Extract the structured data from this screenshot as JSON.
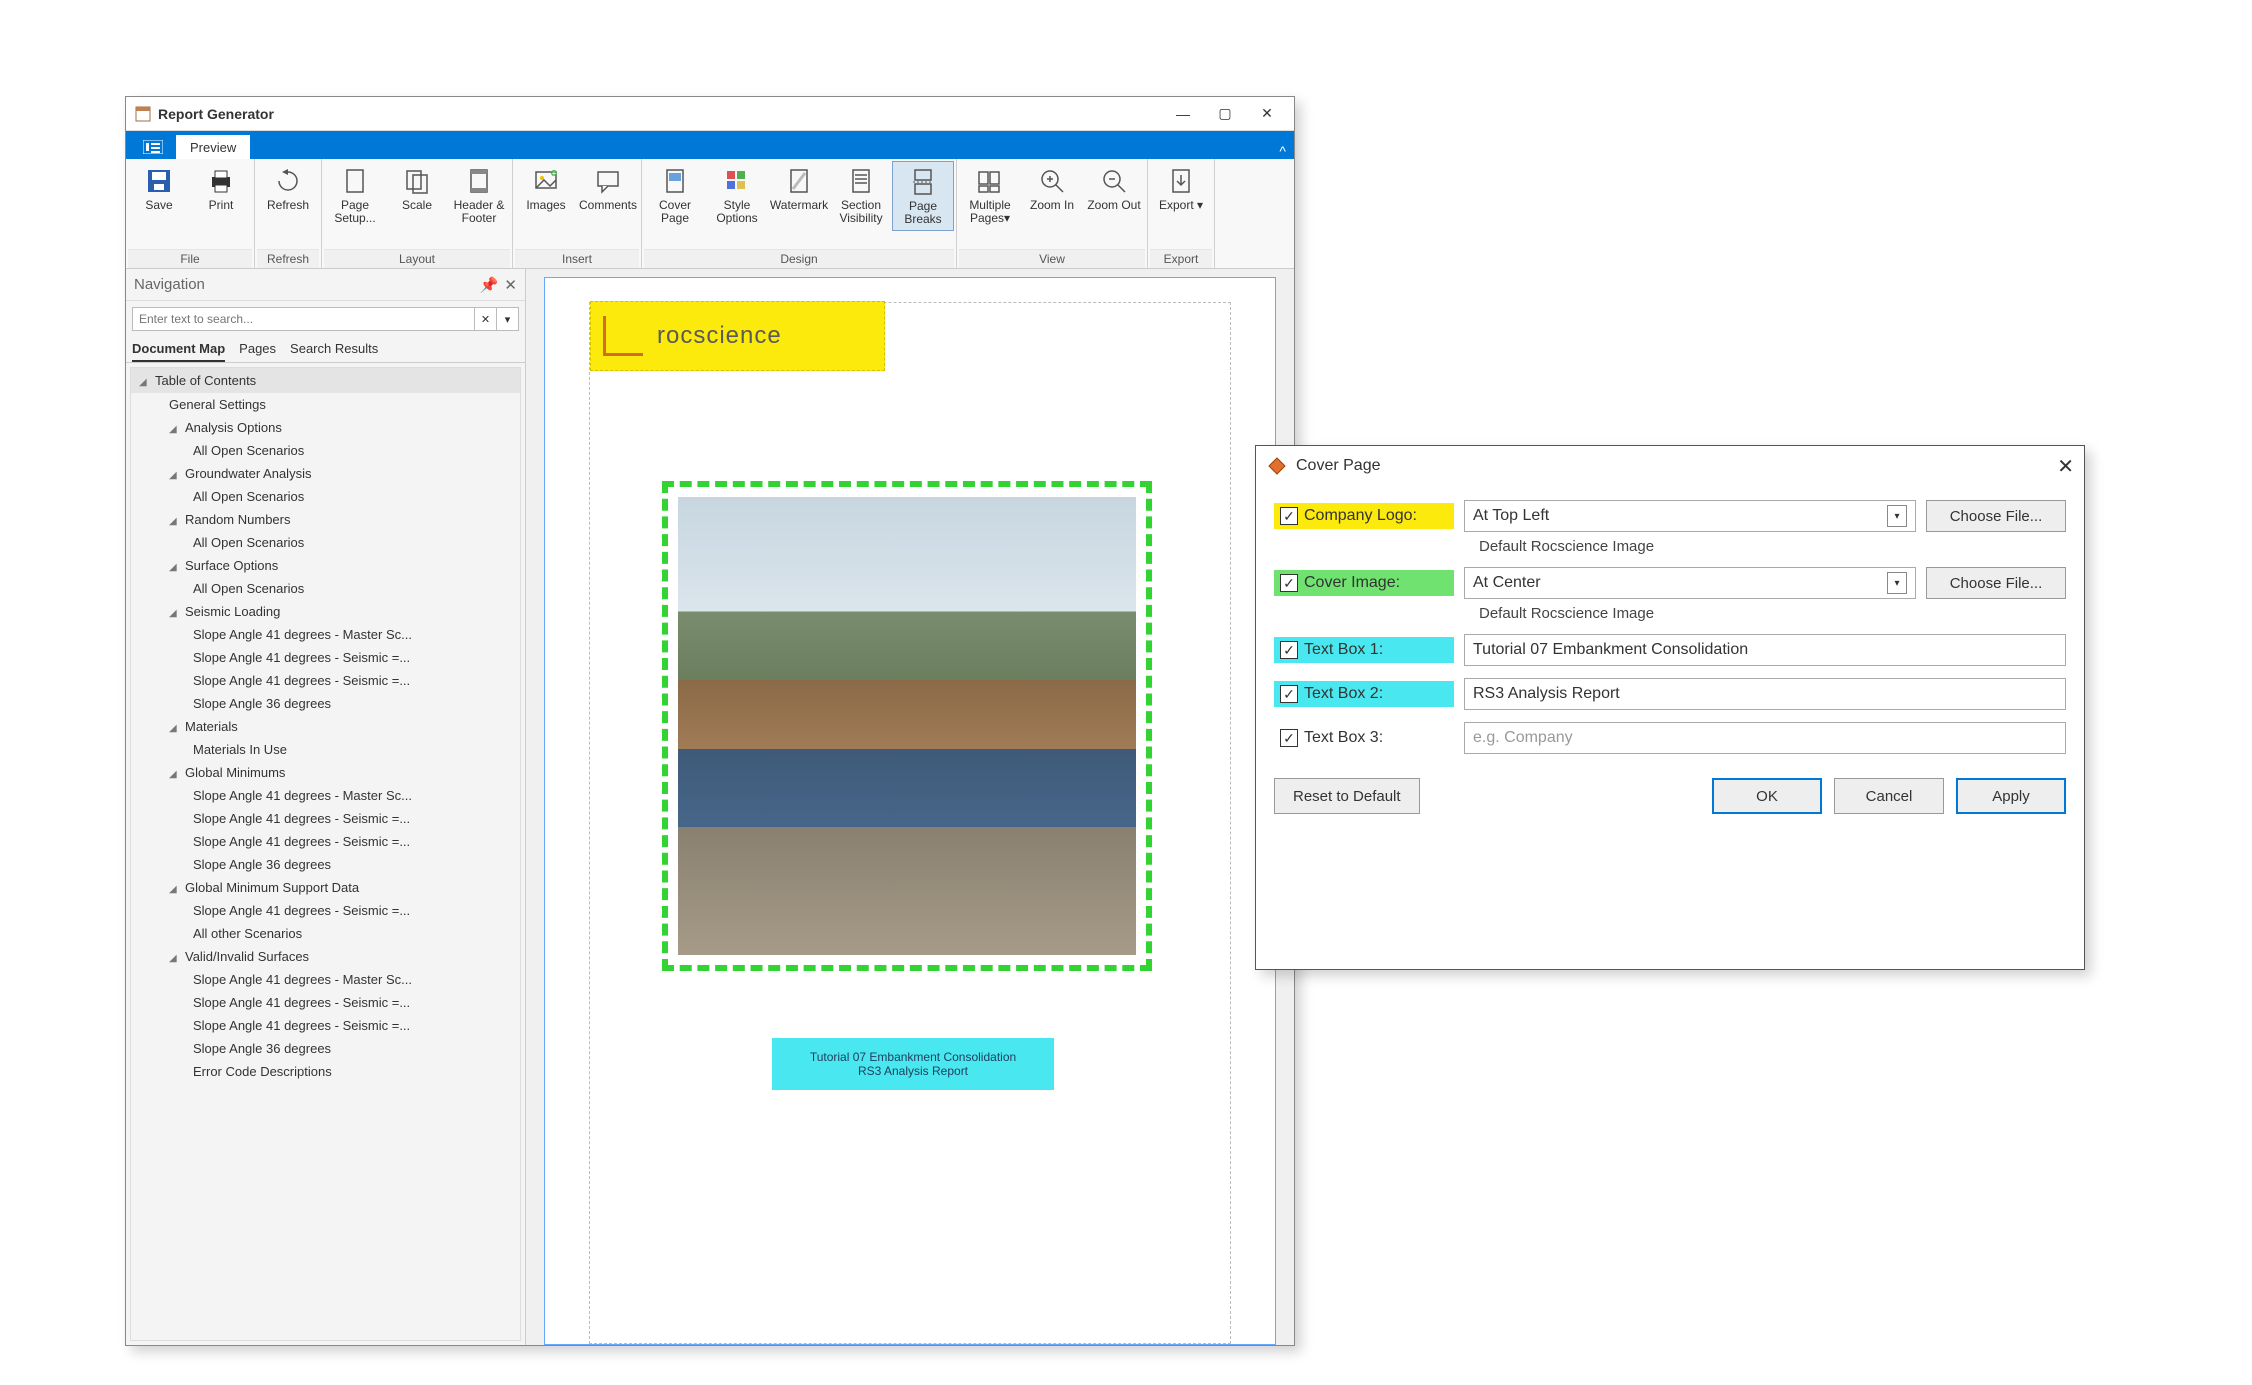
{
  "mainWindow": {
    "title": "Report Generator",
    "ribbonTab": "Preview",
    "ribbon": {
      "groups": [
        {
          "label": "File",
          "buttons": [
            {
              "id": "save",
              "label": "Save"
            },
            {
              "id": "print",
              "label": "Print"
            }
          ]
        },
        {
          "label": "Refresh",
          "buttons": [
            {
              "id": "refresh",
              "label": "Refresh"
            }
          ]
        },
        {
          "label": "Layout",
          "buttons": [
            {
              "id": "page-setup",
              "label": "Page Setup..."
            },
            {
              "id": "scale",
              "label": "Scale"
            },
            {
              "id": "header-footer",
              "label": "Header & Footer"
            }
          ]
        },
        {
          "label": "Insert",
          "buttons": [
            {
              "id": "images",
              "label": "Images"
            },
            {
              "id": "comments",
              "label": "Comments"
            }
          ]
        },
        {
          "label": "Design",
          "buttons": [
            {
              "id": "cover-page",
              "label": "Cover Page"
            },
            {
              "id": "style-options",
              "label": "Style Options"
            },
            {
              "id": "watermark",
              "label": "Watermark"
            },
            {
              "id": "section-visibility",
              "label": "Section Visibility"
            },
            {
              "id": "page-breaks",
              "label": "Page Breaks",
              "active": true
            }
          ]
        },
        {
          "label": "View",
          "buttons": [
            {
              "id": "multiple-pages",
              "label": "Multiple Pages▾"
            },
            {
              "id": "zoom-in",
              "label": "Zoom In"
            },
            {
              "id": "zoom-out",
              "label": "Zoom Out"
            }
          ]
        },
        {
          "label": "Export",
          "buttons": [
            {
              "id": "export",
              "label": "Export ▾"
            }
          ]
        }
      ]
    },
    "nav": {
      "title": "Navigation",
      "searchPlaceholder": "Enter text to search...",
      "tabs": [
        "Document Map",
        "Pages",
        "Search Results"
      ],
      "activeTab": 0,
      "toc": "Table of Contents",
      "items": [
        {
          "t": "General Settings",
          "l": 1
        },
        {
          "t": "Analysis Options",
          "l": 1,
          "exp": true
        },
        {
          "t": "All Open Scenarios",
          "l": 2
        },
        {
          "t": "Groundwater Analysis",
          "l": 1,
          "exp": true
        },
        {
          "t": "All Open Scenarios",
          "l": 2
        },
        {
          "t": "Random Numbers",
          "l": 1,
          "exp": true
        },
        {
          "t": "All Open Scenarios",
          "l": 2
        },
        {
          "t": "Surface Options",
          "l": 1,
          "exp": true
        },
        {
          "t": "All Open Scenarios",
          "l": 2
        },
        {
          "t": "Seismic Loading",
          "l": 1,
          "exp": true
        },
        {
          "t": "Slope Angle 41 degrees - Master Sc...",
          "l": 2
        },
        {
          "t": "Slope Angle 41 degrees - Seismic =...",
          "l": 2
        },
        {
          "t": "Slope Angle 41 degrees - Seismic =...",
          "l": 2
        },
        {
          "t": "Slope Angle 36 degrees",
          "l": 2
        },
        {
          "t": "Materials",
          "l": 1,
          "exp": true
        },
        {
          "t": "Materials In Use",
          "l": 2
        },
        {
          "t": "Global Minimums",
          "l": 1,
          "exp": true
        },
        {
          "t": "Slope Angle 41 degrees - Master Sc...",
          "l": 2
        },
        {
          "t": "Slope Angle 41 degrees - Seismic =...",
          "l": 2
        },
        {
          "t": "Slope Angle 41 degrees - Seismic =...",
          "l": 2
        },
        {
          "t": "Slope Angle 36 degrees",
          "l": 2
        },
        {
          "t": "Global Minimum Support Data",
          "l": 1,
          "exp": true
        },
        {
          "t": "Slope Angle 41 degrees - Seismic =...",
          "l": 2
        },
        {
          "t": "All other Scenarios",
          "l": 2
        },
        {
          "t": "Valid/Invalid Surfaces",
          "l": 1,
          "exp": true
        },
        {
          "t": "Slope Angle 41 degrees - Master Sc...",
          "l": 2
        },
        {
          "t": "Slope Angle 41 degrees - Seismic =...",
          "l": 2
        },
        {
          "t": "Slope Angle 41 degrees - Seismic =...",
          "l": 2
        },
        {
          "t": "Slope Angle 36 degrees",
          "l": 2
        },
        {
          "t": "Error Code Descriptions",
          "l": 2
        }
      ]
    },
    "preview": {
      "logoText": "rocscience",
      "textBox1": "Tutorial 07 Embankment Consolidation",
      "textBox2": "RS3 Analysis Report"
    }
  },
  "dialog": {
    "title": "Cover Page",
    "rows": {
      "companyLogo": {
        "label": "Company Logo:",
        "value": "At Top Left",
        "button": "Choose File...",
        "sub": "Default Rocscience Image"
      },
      "coverImage": {
        "label": "Cover Image:",
        "value": "At Center",
        "button": "Choose File...",
        "sub": "Default Rocscience Image"
      },
      "textBox1": {
        "label": "Text Box 1:",
        "value": "Tutorial 07 Embankment Consolidation"
      },
      "textBox2": {
        "label": "Text Box 2:",
        "value": "RS3 Analysis Report"
      },
      "textBox3": {
        "label": "Text Box 3:",
        "placeholder": "e.g. Company"
      }
    },
    "footer": {
      "reset": "Reset to Default",
      "ok": "OK",
      "cancel": "Cancel",
      "apply": "Apply"
    }
  }
}
